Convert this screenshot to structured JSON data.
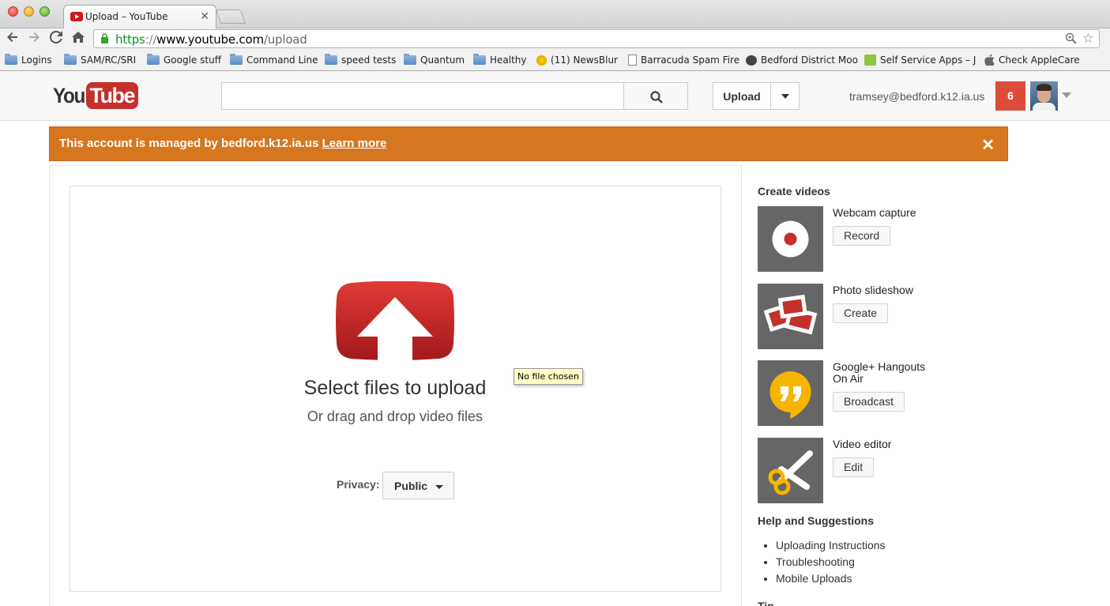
{
  "browser": {
    "tab_title": "Upload – YouTube",
    "tab_close": "✕",
    "url_https": "https",
    "url_sep": "://",
    "url_host": "www.youtube.com",
    "url_path": "/upload",
    "bookmarks": [
      {
        "label": "Logins",
        "icon": "folder-icon"
      },
      {
        "label": "SAM/RC/SRI",
        "icon": "folder-icon"
      },
      {
        "label": "Google stuff",
        "icon": "folder-icon"
      },
      {
        "label": "Command Line",
        "icon": "folder-icon"
      },
      {
        "label": "speed tests",
        "icon": "folder-icon"
      },
      {
        "label": "Quantum",
        "icon": "folder-icon"
      },
      {
        "label": "Healthy",
        "icon": "folder-icon"
      },
      {
        "label": "(11) NewsBlur",
        "icon": "newsblur-icon"
      },
      {
        "label": "Barracuda Spam Fire",
        "icon": "page-icon"
      },
      {
        "label": "Bedford District Moo",
        "icon": "moodle-icon"
      },
      {
        "label": "Self Service Apps – J",
        "icon": "jss-icon"
      },
      {
        "label": "Check AppleCare",
        "icon": "apple-icon"
      }
    ]
  },
  "header": {
    "logo_you": "You",
    "logo_tube": "Tube",
    "search_placeholder": "",
    "upload_label": "Upload",
    "account_email": "tramsey@bedford.k12.ia.us",
    "notification_count": "6"
  },
  "banner": {
    "text": "This account is managed by bedford.k12.ia.us ",
    "link": "Learn more",
    "close": "✕",
    "color": "#d67720"
  },
  "upload": {
    "title": "Select files to upload",
    "subtitle": "Or drag and drop video files",
    "tooltip": "No file chosen",
    "privacy_label": "Privacy:",
    "privacy_value": "Public"
  },
  "sidebar": {
    "create_title": "Create videos",
    "items": [
      {
        "label": "Webcam capture",
        "button": "Record",
        "icon": "record-icon"
      },
      {
        "label": "Photo slideshow",
        "button": "Create",
        "icon": "slideshow-icon"
      },
      {
        "label": "Google+ Hangouts On Air",
        "button": "Broadcast",
        "icon": "hangouts-icon"
      },
      {
        "label": "Video editor",
        "button": "Edit",
        "icon": "scissors-icon"
      }
    ],
    "help_title": "Help and Suggestions",
    "help_links": [
      "Uploading Instructions",
      "Troubleshooting",
      "Mobile Uploads"
    ],
    "tip_title": "Tip"
  },
  "colors": {
    "youtube_red": "#c4302b",
    "badge_red": "#dd4b39",
    "hangouts_yellow": "#f7b500"
  }
}
